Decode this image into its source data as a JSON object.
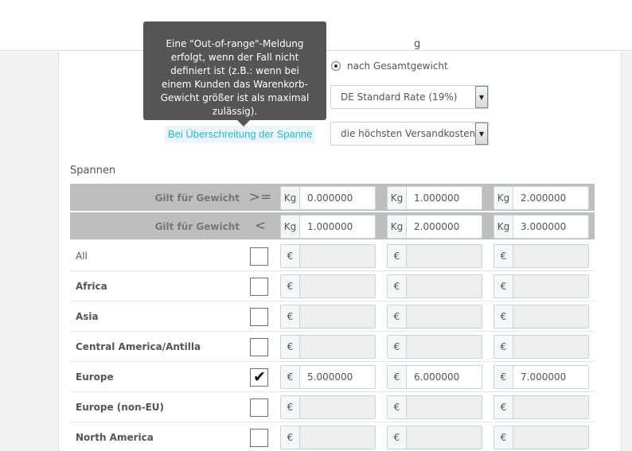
{
  "header_partial_text": "g",
  "radio": {
    "label": "nach Gesamtgewicht"
  },
  "tax_select": {
    "value": "DE Standard Rate (19%)"
  },
  "range_behavior": {
    "label": "Bei Überschreitung der Spanne",
    "value": "die höchsten Versandkosten"
  },
  "tooltip": {
    "text": "Eine \"Out-of-range\"-Meldung erfolgt, wenn der Fall nicht definiert ist (z.B.: wenn bei einem Kunden das Warenkorb-Gewicht größer ist als maximal zulässig)."
  },
  "ranges": {
    "title": "Spannen",
    "header_rows": [
      {
        "label": "Gilt für Gewicht",
        "symbol": ">=",
        "unit": "Kg",
        "values": [
          "0.000000",
          "1.000000",
          "2.000000"
        ]
      },
      {
        "label": "Gilt für Gewicht",
        "symbol": "<",
        "unit": "Kg",
        "values": [
          "1.000000",
          "2.000000",
          "3.000000"
        ]
      }
    ],
    "currency": "€",
    "zones": [
      {
        "name": "All",
        "checked": false,
        "values": [
          "",
          "",
          ""
        ]
      },
      {
        "name": "Africa",
        "checked": false,
        "values": [
          "",
          "",
          ""
        ]
      },
      {
        "name": "Asia",
        "checked": false,
        "values": [
          "",
          "",
          ""
        ]
      },
      {
        "name": "Central America/Antilla",
        "checked": false,
        "values": [
          "",
          "",
          ""
        ]
      },
      {
        "name": "Europe",
        "checked": true,
        "values": [
          "5.000000",
          "6.000000",
          "7.000000"
        ]
      },
      {
        "name": "Europe (non-EU)",
        "checked": false,
        "values": [
          "",
          "",
          ""
        ]
      },
      {
        "name": "North America",
        "checked": false,
        "values": [
          "",
          "",
          ""
        ]
      }
    ]
  }
}
